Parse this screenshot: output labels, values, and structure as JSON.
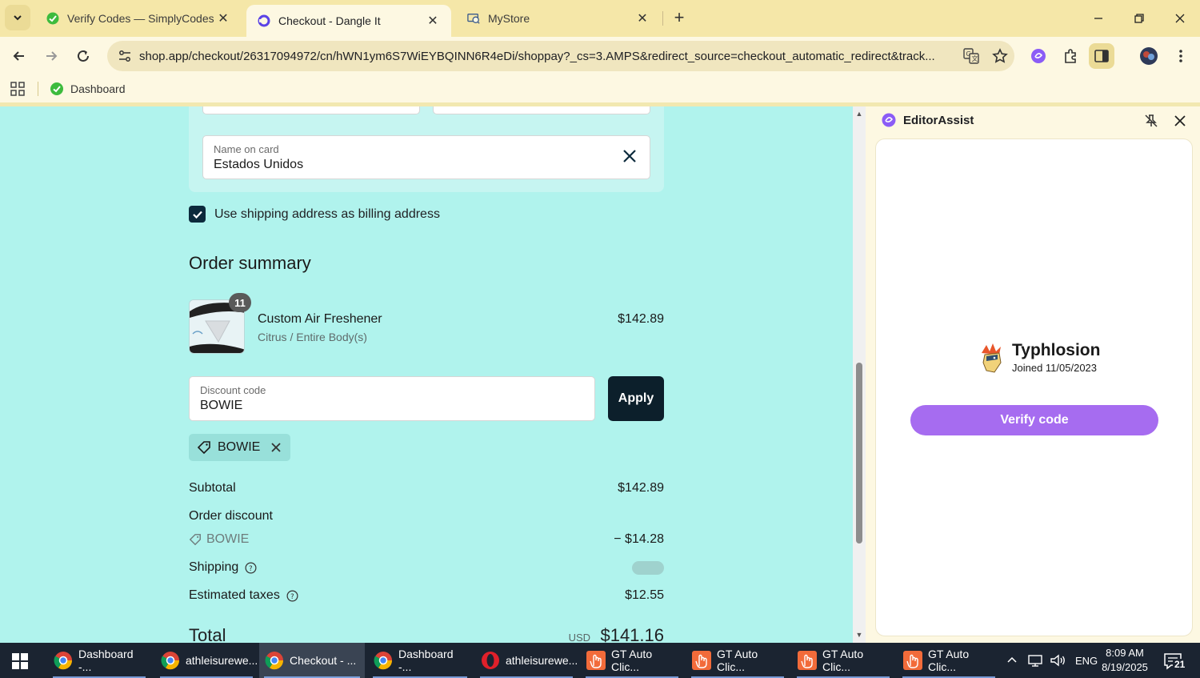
{
  "browser": {
    "tabs": [
      {
        "title": "Verify Codes — SimplyCodes",
        "active": false
      },
      {
        "title": "Checkout - Dangle It",
        "active": true
      },
      {
        "title": "MyStore",
        "active": false
      }
    ],
    "url": "shop.app/checkout/26317094972/cn/hWN1ym6S7WiEYBQINN6R4eDi/shoppay?_cs=3.AMPS&redirect_source=checkout_automatic_redirect&track...",
    "bookmarks": [
      {
        "label": "Dashboard"
      }
    ]
  },
  "checkout": {
    "name_on_card": {
      "label": "Name on card",
      "value": "Estados Unidos"
    },
    "billing_checkbox": {
      "label": "Use shipping address as billing address",
      "checked": true
    },
    "order_summary_title": "Order summary",
    "product": {
      "quantity": "11",
      "name": "Custom Air Freshener",
      "variant": "Citrus / Entire Body(s)",
      "price": "$142.89"
    },
    "discount": {
      "label": "Discount code",
      "value": "BOWIE",
      "apply_label": "Apply",
      "applied_tag": "BOWIE"
    },
    "subtotal": {
      "label": "Subtotal",
      "value": "$142.89"
    },
    "order_discount": {
      "label": "Order discount",
      "code": "BOWIE",
      "value": "− $14.28"
    },
    "shipping": {
      "label": "Shipping"
    },
    "taxes": {
      "label": "Estimated taxes",
      "value": "$12.55"
    },
    "total": {
      "label": "Total",
      "currency": "USD",
      "value": "$141.16"
    }
  },
  "side_panel": {
    "title": "EditorAssist",
    "user": {
      "name": "Typhlosion",
      "joined": "Joined 11/05/2023"
    },
    "verify_button": "Verify code"
  },
  "taskbar": {
    "items": [
      {
        "label": "Dashboard -...",
        "icon": "chrome-icon"
      },
      {
        "label": "athleisurewe...",
        "icon": "chrome-icon"
      },
      {
        "label": "Checkout - ...",
        "icon": "chrome-icon",
        "active": true
      },
      {
        "label": "Dashboard -...",
        "icon": "chrome-icon"
      },
      {
        "label": "athleisurewe...",
        "icon": "opera-icon"
      },
      {
        "label": "GT Auto Clic...",
        "icon": "hand-icon"
      },
      {
        "label": "GT Auto Clic...",
        "icon": "hand-icon"
      },
      {
        "label": "GT Auto Clic...",
        "icon": "hand-icon"
      },
      {
        "label": "GT Auto Clic...",
        "icon": "hand-icon"
      }
    ],
    "language": "ENG",
    "time": "8:09 AM",
    "date": "8/19/2025",
    "notifications": "21"
  },
  "colors": {
    "page_bg": "#b0f3ed",
    "primary_button": "#0c1f2b",
    "verify_button": "#a66cf0",
    "chrome_theme": "#f5e7a8"
  }
}
